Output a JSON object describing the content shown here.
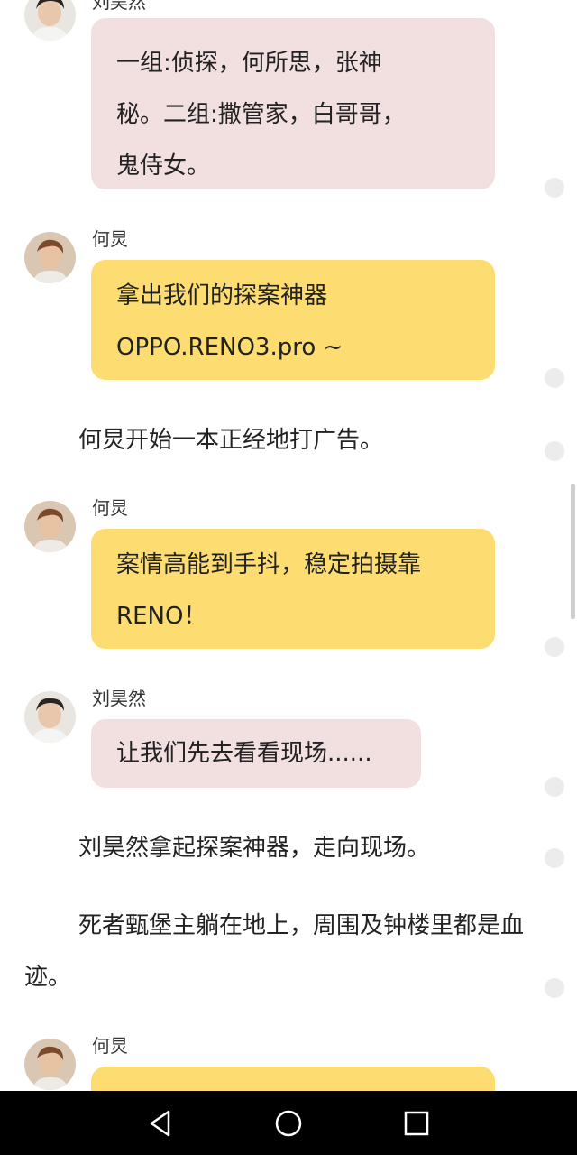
{
  "messages": [
    {
      "speaker": "刘昊然",
      "text": "一组:侦探，何所思，张神\n秘。二组:撒管家，白哥哥，\n鬼侍女。"
    },
    {
      "speaker": "何炅",
      "text": "拿出我们的探案神器\nOPPO.RENO3.pro ~"
    },
    {
      "narration": "何炅开始一本正经地打广告。"
    },
    {
      "speaker": "何炅",
      "text": "案情高能到手抖，稳定拍摄靠\nRENO！"
    },
    {
      "speaker": "刘昊然",
      "text": "让我们先去看看现场......"
    },
    {
      "narration": "刘昊然拿起探案神器，走向现场。"
    },
    {
      "narration": "死者甄堡主躺在地上，周围及钟楼里都是血迹。"
    },
    {
      "speaker": "何炅",
      "text": ""
    }
  ],
  "colors": {
    "bubble_pink": "#f2dfe0",
    "bubble_yellow": "#fddd72",
    "navbar": "#000000"
  },
  "navbar": {
    "back": "back-triangle-icon",
    "home": "home-circle-icon",
    "recents": "recents-square-icon"
  }
}
